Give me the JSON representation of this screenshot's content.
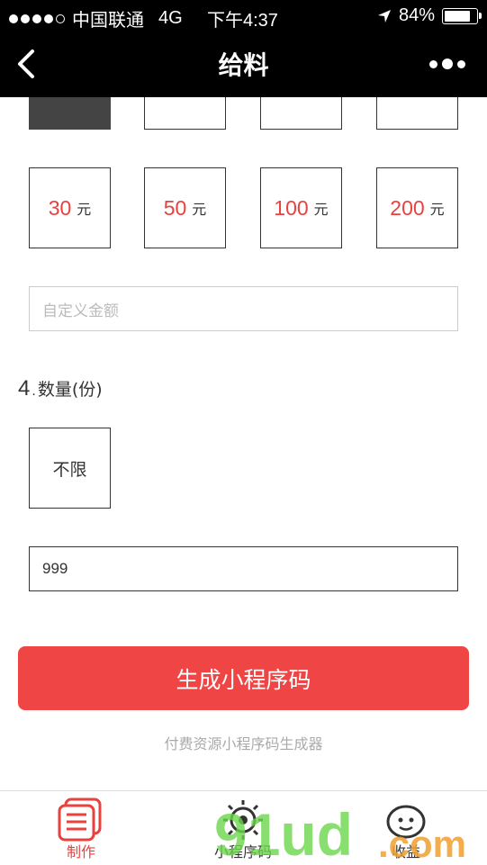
{
  "status_bar": {
    "carrier": "中国联通",
    "network": "4G",
    "time": "下午4:37",
    "battery": "84%",
    "battery_level": 0.84
  },
  "nav": {
    "title": "给料",
    "back_icon": "chevron-left-icon",
    "more_icon": "more-dots-icon"
  },
  "amounts": [
    {
      "value": "30",
      "unit": "元"
    },
    {
      "value": "50",
      "unit": "元"
    },
    {
      "value": "100",
      "unit": "元"
    },
    {
      "value": "200",
      "unit": "元"
    }
  ],
  "custom_amount": {
    "placeholder": "自定义金额"
  },
  "quantity": {
    "index": "4",
    "title": "数量(份)",
    "unlimited_label": "不限",
    "value": "999"
  },
  "generate_button": "生成小程序码",
  "caption": "付费资源小程序码生成器",
  "tabbar": {
    "tabs": [
      {
        "label": "制作",
        "icon": "document-stack-icon",
        "active": true
      },
      {
        "label": "小程序码",
        "icon": "qrcode-icon",
        "active": false
      },
      {
        "label": "收益",
        "icon": "coin-icon",
        "active": false
      }
    ]
  },
  "colors": {
    "accent": "#e8413e",
    "button": "#f04545",
    "nav_bg": "#000000"
  }
}
